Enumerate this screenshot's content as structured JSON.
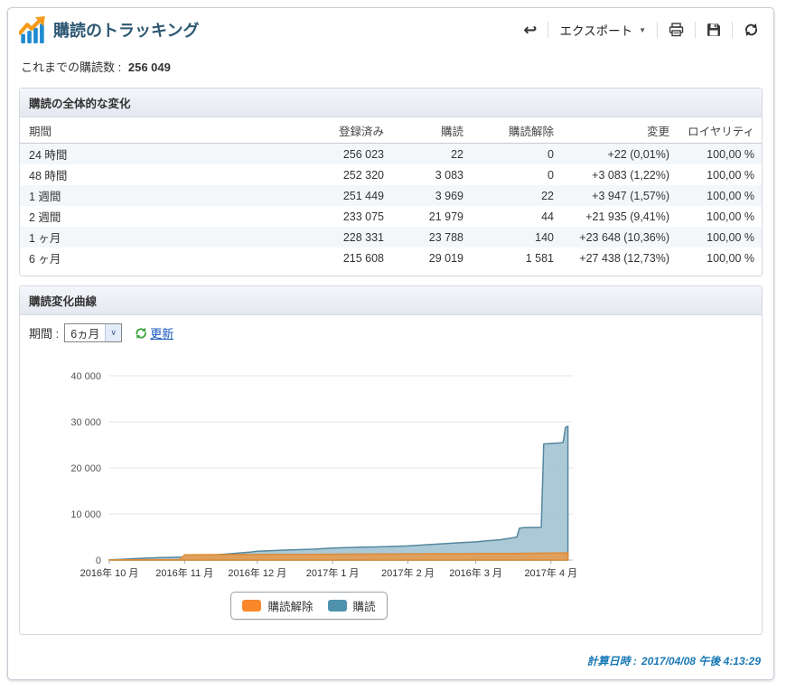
{
  "header": {
    "title": "購読のトラッキング",
    "toolbar": {
      "export_label": "エクスポート"
    }
  },
  "summary": {
    "label": "これまでの購読数 :",
    "value": "256 049"
  },
  "overview": {
    "section_title": "購読の全体的な変化",
    "columns": [
      "期間",
      "登録済み",
      "購読",
      "購読解除",
      "変更",
      "ロイヤリティ"
    ],
    "rows": [
      {
        "period": "24 時間",
        "registered": "256 023",
        "subscribed": "22",
        "unsubscribed": "0",
        "change": "+22 (0,01%)",
        "loyalty": "100,00 %"
      },
      {
        "period": "48 時間",
        "registered": "252 320",
        "subscribed": "3 083",
        "unsubscribed": "0",
        "change": "+3 083 (1,22%)",
        "loyalty": "100,00 %"
      },
      {
        "period": "1 週間",
        "registered": "251 449",
        "subscribed": "3 969",
        "unsubscribed": "22",
        "change": "+3 947 (1,57%)",
        "loyalty": "100,00 %"
      },
      {
        "period": "2 週間",
        "registered": "233 075",
        "subscribed": "21 979",
        "unsubscribed": "44",
        "change": "+21 935 (9,41%)",
        "loyalty": "100,00 %"
      },
      {
        "period": "1 ヶ月",
        "registered": "228 331",
        "subscribed": "23 788",
        "unsubscribed": "140",
        "change": "+23 648 (10,36%)",
        "loyalty": "100,00 %"
      },
      {
        "period": "6 ヶ月",
        "registered": "215 608",
        "subscribed": "29 019",
        "unsubscribed": "1 581",
        "change": "+27 438 (12,73%)",
        "loyalty": "100,00 %"
      }
    ]
  },
  "curve": {
    "section_title": "購読変化曲線",
    "period_label": "期間 :",
    "period_value": "6ヵ月",
    "refresh_label": "更新"
  },
  "chart_data": {
    "type": "area",
    "title": "",
    "ylim": [
      0,
      40000
    ],
    "x_domain_days": [
      0,
      191
    ],
    "grid": true,
    "y_ticks": [
      {
        "label": "0",
        "value": 0
      },
      {
        "label": "10 000",
        "value": 10000
      },
      {
        "label": "20 000",
        "value": 20000
      },
      {
        "label": "30 000",
        "value": 30000
      },
      {
        "label": "40 000",
        "value": 40000
      }
    ],
    "x_ticks": [
      {
        "label": "2016年 10 月",
        "day": 0
      },
      {
        "label": "2016年 11 月",
        "day": 31
      },
      {
        "label": "2016年 12 月",
        "day": 61
      },
      {
        "label": "2017年 1 月",
        "day": 92
      },
      {
        "label": "2017年 2 月",
        "day": 123
      },
      {
        "label": "2016年 3 月",
        "day": 151
      },
      {
        "label": "2017年 4 月",
        "day": 182
      }
    ],
    "legend": [
      {
        "label": "購読解除",
        "color": "#f8882a"
      },
      {
        "label": "購読",
        "color": "#4e92ad"
      }
    ],
    "series": [
      {
        "name": "購読",
        "fill": "#a8c6d5",
        "stroke": "#55889f",
        "opacity": 0.95,
        "points": [
          [
            0,
            30
          ],
          [
            5,
            150
          ],
          [
            10,
            300
          ],
          [
            15,
            420
          ],
          [
            20,
            500
          ],
          [
            25,
            560
          ],
          [
            30,
            640
          ],
          [
            31,
            700
          ],
          [
            36,
            850
          ],
          [
            42,
            1050
          ],
          [
            48,
            1300
          ],
          [
            54,
            1550
          ],
          [
            58,
            1700
          ],
          [
            61,
            1900
          ],
          [
            66,
            2000
          ],
          [
            72,
            2150
          ],
          [
            78,
            2250
          ],
          [
            84,
            2350
          ],
          [
            92,
            2600
          ],
          [
            98,
            2700
          ],
          [
            104,
            2780
          ],
          [
            110,
            2850
          ],
          [
            116,
            2950
          ],
          [
            123,
            3050
          ],
          [
            129,
            3250
          ],
          [
            135,
            3450
          ],
          [
            141,
            3650
          ],
          [
            146,
            3800
          ],
          [
            151,
            3950
          ],
          [
            156,
            4200
          ],
          [
            161,
            4400
          ],
          [
            166,
            4800
          ],
          [
            168,
            5000
          ],
          [
            169,
            6900
          ],
          [
            171,
            7050
          ],
          [
            178,
            7100
          ],
          [
            179,
            25200
          ],
          [
            183,
            25350
          ],
          [
            186,
            25450
          ],
          [
            187,
            25550
          ],
          [
            188,
            28800
          ],
          [
            189,
            29019
          ]
        ]
      },
      {
        "name": "購読解除",
        "fill": "#dfa05e",
        "stroke": "#df8a33",
        "opacity": 1,
        "points": [
          [
            0,
            20
          ],
          [
            10,
            45
          ],
          [
            20,
            70
          ],
          [
            29,
            90
          ],
          [
            31,
            1120
          ],
          [
            36,
            1150
          ],
          [
            45,
            1170
          ],
          [
            61,
            1200
          ],
          [
            80,
            1230
          ],
          [
            92,
            1260
          ],
          [
            110,
            1300
          ],
          [
            123,
            1330
          ],
          [
            140,
            1370
          ],
          [
            151,
            1400
          ],
          [
            165,
            1440
          ],
          [
            175,
            1470
          ],
          [
            183,
            1500
          ],
          [
            187,
            1530
          ],
          [
            189,
            1581
          ]
        ]
      }
    ]
  },
  "footer": {
    "label": "計算日時 :",
    "value": "2017/04/08 午後 4:13:29"
  }
}
